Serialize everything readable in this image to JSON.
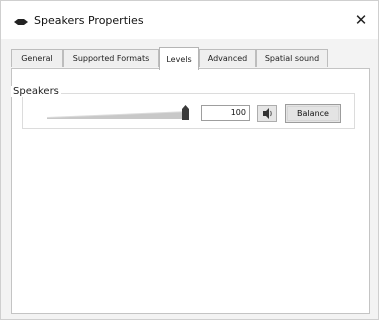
{
  "window": {
    "title": "Speakers Properties",
    "close_glyph": "✕",
    "title_icon": "speaker-icon"
  },
  "tabs": [
    {
      "label": "General",
      "active": false
    },
    {
      "label": "Supported Formats",
      "active": false
    },
    {
      "label": "Levels",
      "active": true
    },
    {
      "label": "Advanced",
      "active": false
    },
    {
      "label": "Spatial sound",
      "active": false
    }
  ],
  "levels": {
    "group_label": "Speakers",
    "volume_value": "100",
    "volume_fraction": 1.0,
    "mute_icon": "speaker-mute-icon",
    "balance_label": "Balance"
  }
}
